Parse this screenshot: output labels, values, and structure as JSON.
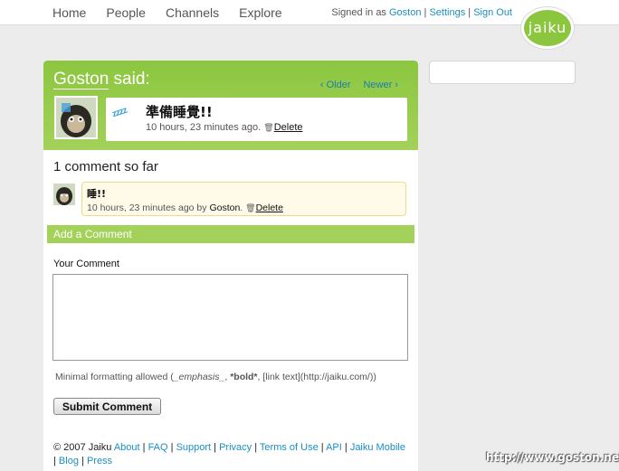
{
  "nav": {
    "items": [
      "Home",
      "People",
      "Channels",
      "Explore"
    ]
  },
  "signin": {
    "prefix": "Signed in as",
    "user": "Goston",
    "settings": "Settings",
    "signout": "Sign Out",
    "sep": "|"
  },
  "logo": {
    "text": "jaiku"
  },
  "post": {
    "user": "Goston",
    "said": "said:",
    "older": "‹ Older",
    "newer": "Newer ›",
    "zzz": "zzzz",
    "text": "準備睡覺!!",
    "meta": "10 hours, 23 minutes ago.",
    "delete": "Delete"
  },
  "comments": {
    "count": "1 comment so far",
    "items": [
      {
        "text": "睡!!",
        "meta_time": "10 hours, 23 minutes ago by",
        "author": "Goston",
        "delete": "Delete"
      }
    ]
  },
  "form": {
    "header": "Add a Comment",
    "label": "Your Comment",
    "hint_prefix": "Minimal formatting allowed (",
    "hint_em": "_emphasis_",
    "hint_mid": ", ",
    "hint_bold": "*bold*",
    "hint_suffix": ", [link text](http://jaiku.com/))",
    "submit": "Submit Comment"
  },
  "footer": {
    "copyright": "© 2007 Jaiku",
    "links": [
      "About",
      "FAQ",
      "Support",
      "Privacy",
      "Terms of Use",
      "API",
      "Jaiku Mobile",
      "Blog",
      "Press"
    ]
  },
  "watermark": "http://www.goston.net/",
  "colors": {
    "accent_green": "#8cc63f",
    "link_blue": "#1a8fc0",
    "comment_bg": "#fffbe8"
  }
}
